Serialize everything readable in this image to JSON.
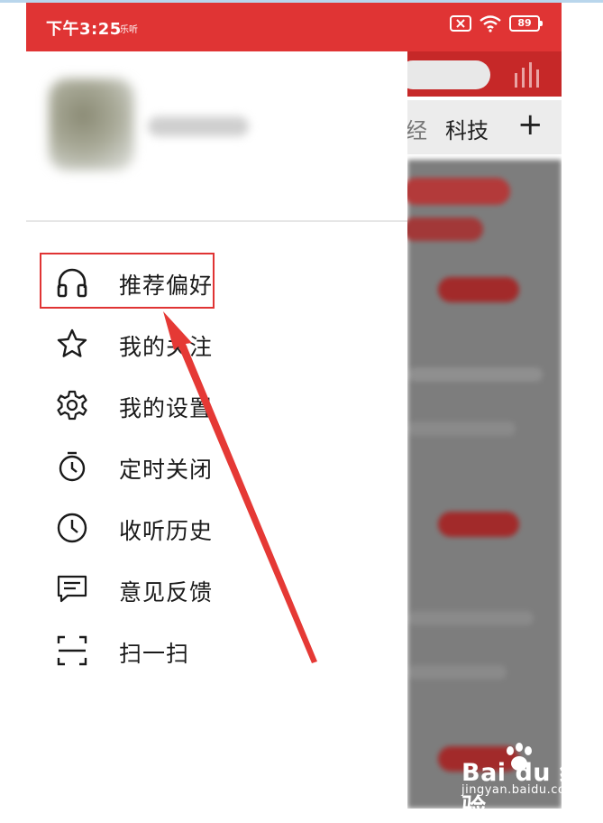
{
  "status_bar": {
    "time": "下午3:25",
    "sub_label": "乐听",
    "battery": "89",
    "icons": [
      "sim-error-icon",
      "wifi-icon",
      "battery-icon"
    ]
  },
  "drawer": {
    "menu": [
      {
        "label": "推荐偏好",
        "icon": "headphones-icon"
      },
      {
        "label": "我的关注",
        "icon": "star-icon"
      },
      {
        "label": "我的设置",
        "icon": "gear-icon"
      },
      {
        "label": "定时关闭",
        "icon": "timer-icon"
      },
      {
        "label": "收听历史",
        "icon": "clock-icon"
      },
      {
        "label": "意见反馈",
        "icon": "feedback-icon"
      },
      {
        "label": "扫一扫",
        "icon": "scan-icon"
      }
    ]
  },
  "background_app": {
    "tab_partial": "经",
    "tab_visible": "科技",
    "add_tab": "+"
  },
  "watermark": {
    "brand": "Bai du 经验",
    "url": "jingyan.baidu.com"
  },
  "colors": {
    "accent": "#e03434",
    "header_red": "#c62828"
  }
}
